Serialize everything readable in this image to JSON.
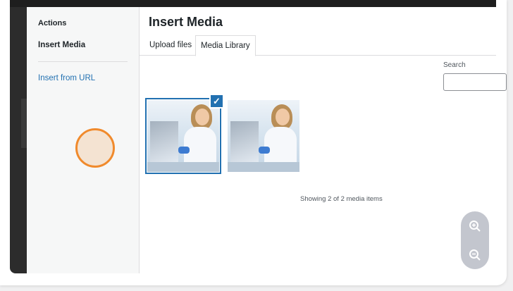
{
  "sidebar": {
    "title": "Actions",
    "items": [
      {
        "label": "Insert Media",
        "active": true
      },
      {
        "label": "Insert from URL",
        "active": false
      }
    ]
  },
  "modal": {
    "title": "Insert Media",
    "tabs": [
      {
        "label": "Upload files"
      },
      {
        "label": "Media Library",
        "selected": true
      }
    ]
  },
  "search": {
    "label": "Search",
    "value": ""
  },
  "media": {
    "items": [
      {
        "name": "lab-scientist-thumbnail",
        "selected": true
      },
      {
        "name": "lab-scientist-thumbnail",
        "selected": false
      }
    ],
    "status": "Showing 2 of 2 media items"
  },
  "zoom_controls": [
    "zoom-in-icon",
    "zoom-out-icon"
  ],
  "colors": {
    "accent": "#2271b1",
    "cursor_ring": "#f08a2c",
    "sidebar_bg": "#f6f7f7"
  }
}
